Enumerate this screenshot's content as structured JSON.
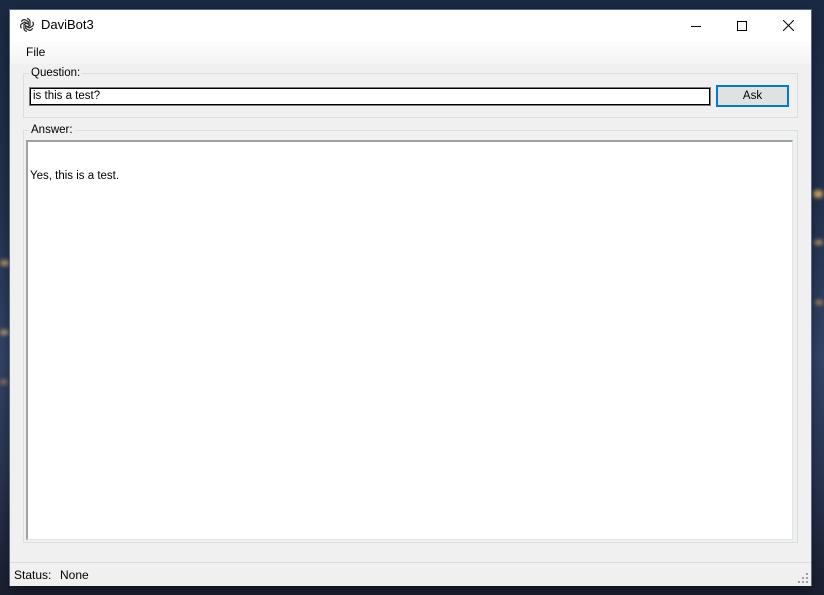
{
  "window": {
    "title": "DaviBot3",
    "icon": "openai-knot-icon"
  },
  "menu": {
    "items": [
      {
        "label": "File"
      }
    ]
  },
  "question": {
    "group_label": "Question:",
    "input_value": "is this a test?",
    "ask_label": "Ask"
  },
  "answer": {
    "group_label": "Answer:",
    "text": "Yes, this is a test."
  },
  "status": {
    "label": "Status:",
    "value": "None"
  },
  "colors": {
    "accent": "#0078d7",
    "window_bg": "#f0f0f0",
    "titlebar_bg": "#ffffff"
  }
}
